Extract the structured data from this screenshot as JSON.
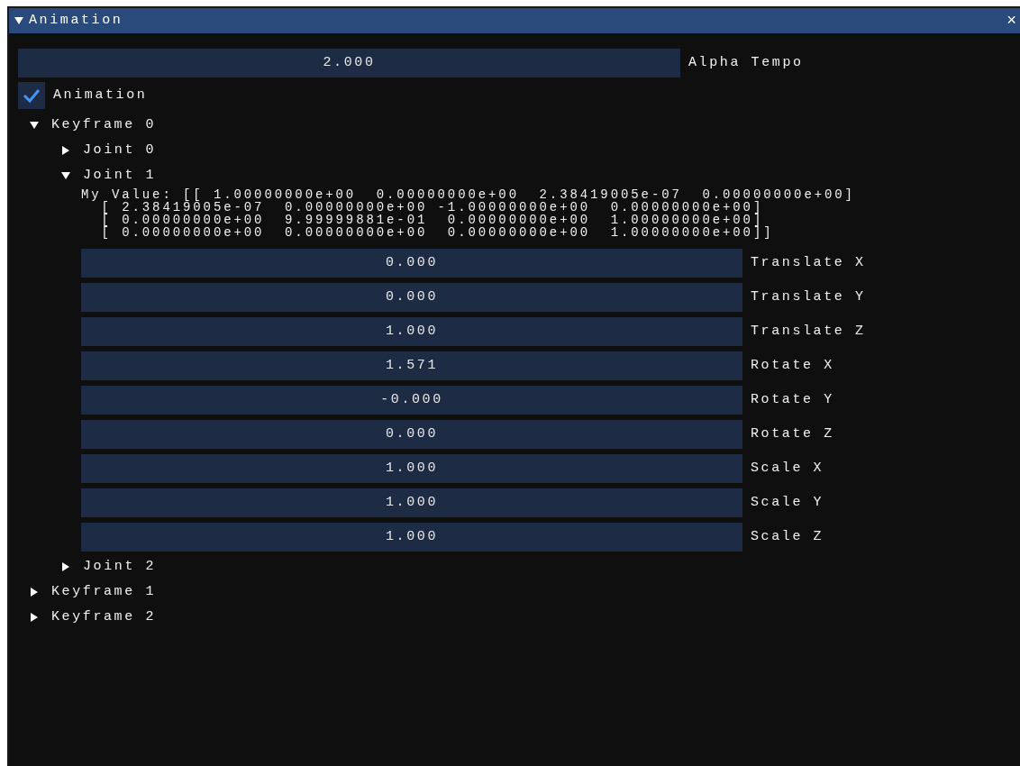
{
  "window": {
    "title": "Animation",
    "collapsed": false,
    "close": "×"
  },
  "alpha_tempo": {
    "value": "2.000",
    "label": "Alpha Tempo"
  },
  "animation_toggle": {
    "label": "Animation",
    "checked": true
  },
  "keyframes": [
    {
      "label": "Keyframe 0",
      "expanded": true,
      "children": [
        {
          "label": "Joint 0",
          "expanded": false
        },
        {
          "label": "Joint 1",
          "expanded": true,
          "matrix": [
            "My Value: [[ 1.00000000e+00  0.00000000e+00  2.38419005e-07  0.00000000e+00]",
            "  [ 2.38419005e-07  0.00000000e+00 -1.00000000e+00  0.00000000e+00]",
            "  [ 0.00000000e+00  9.99999881e-01  0.00000000e+00  1.00000000e+00]",
            "  [ 0.00000000e+00  0.00000000e+00  0.00000000e+00  1.00000000e+00]]"
          ],
          "fields": [
            {
              "value": "0.000",
              "label": "Translate X"
            },
            {
              "value": "0.000",
              "label": "Translate Y"
            },
            {
              "value": "1.000",
              "label": "Translate Z"
            },
            {
              "value": "1.571",
              "label": "Rotate X"
            },
            {
              "value": "-0.000",
              "label": "Rotate Y"
            },
            {
              "value": "0.000",
              "label": "Rotate Z"
            },
            {
              "value": "1.000",
              "label": "Scale X"
            },
            {
              "value": "1.000",
              "label": "Scale Y"
            },
            {
              "value": "1.000",
              "label": "Scale Z"
            }
          ]
        },
        {
          "label": "Joint 2",
          "expanded": false
        }
      ]
    },
    {
      "label": "Keyframe 1",
      "expanded": false
    },
    {
      "label": "Keyframe 2",
      "expanded": false
    }
  ]
}
